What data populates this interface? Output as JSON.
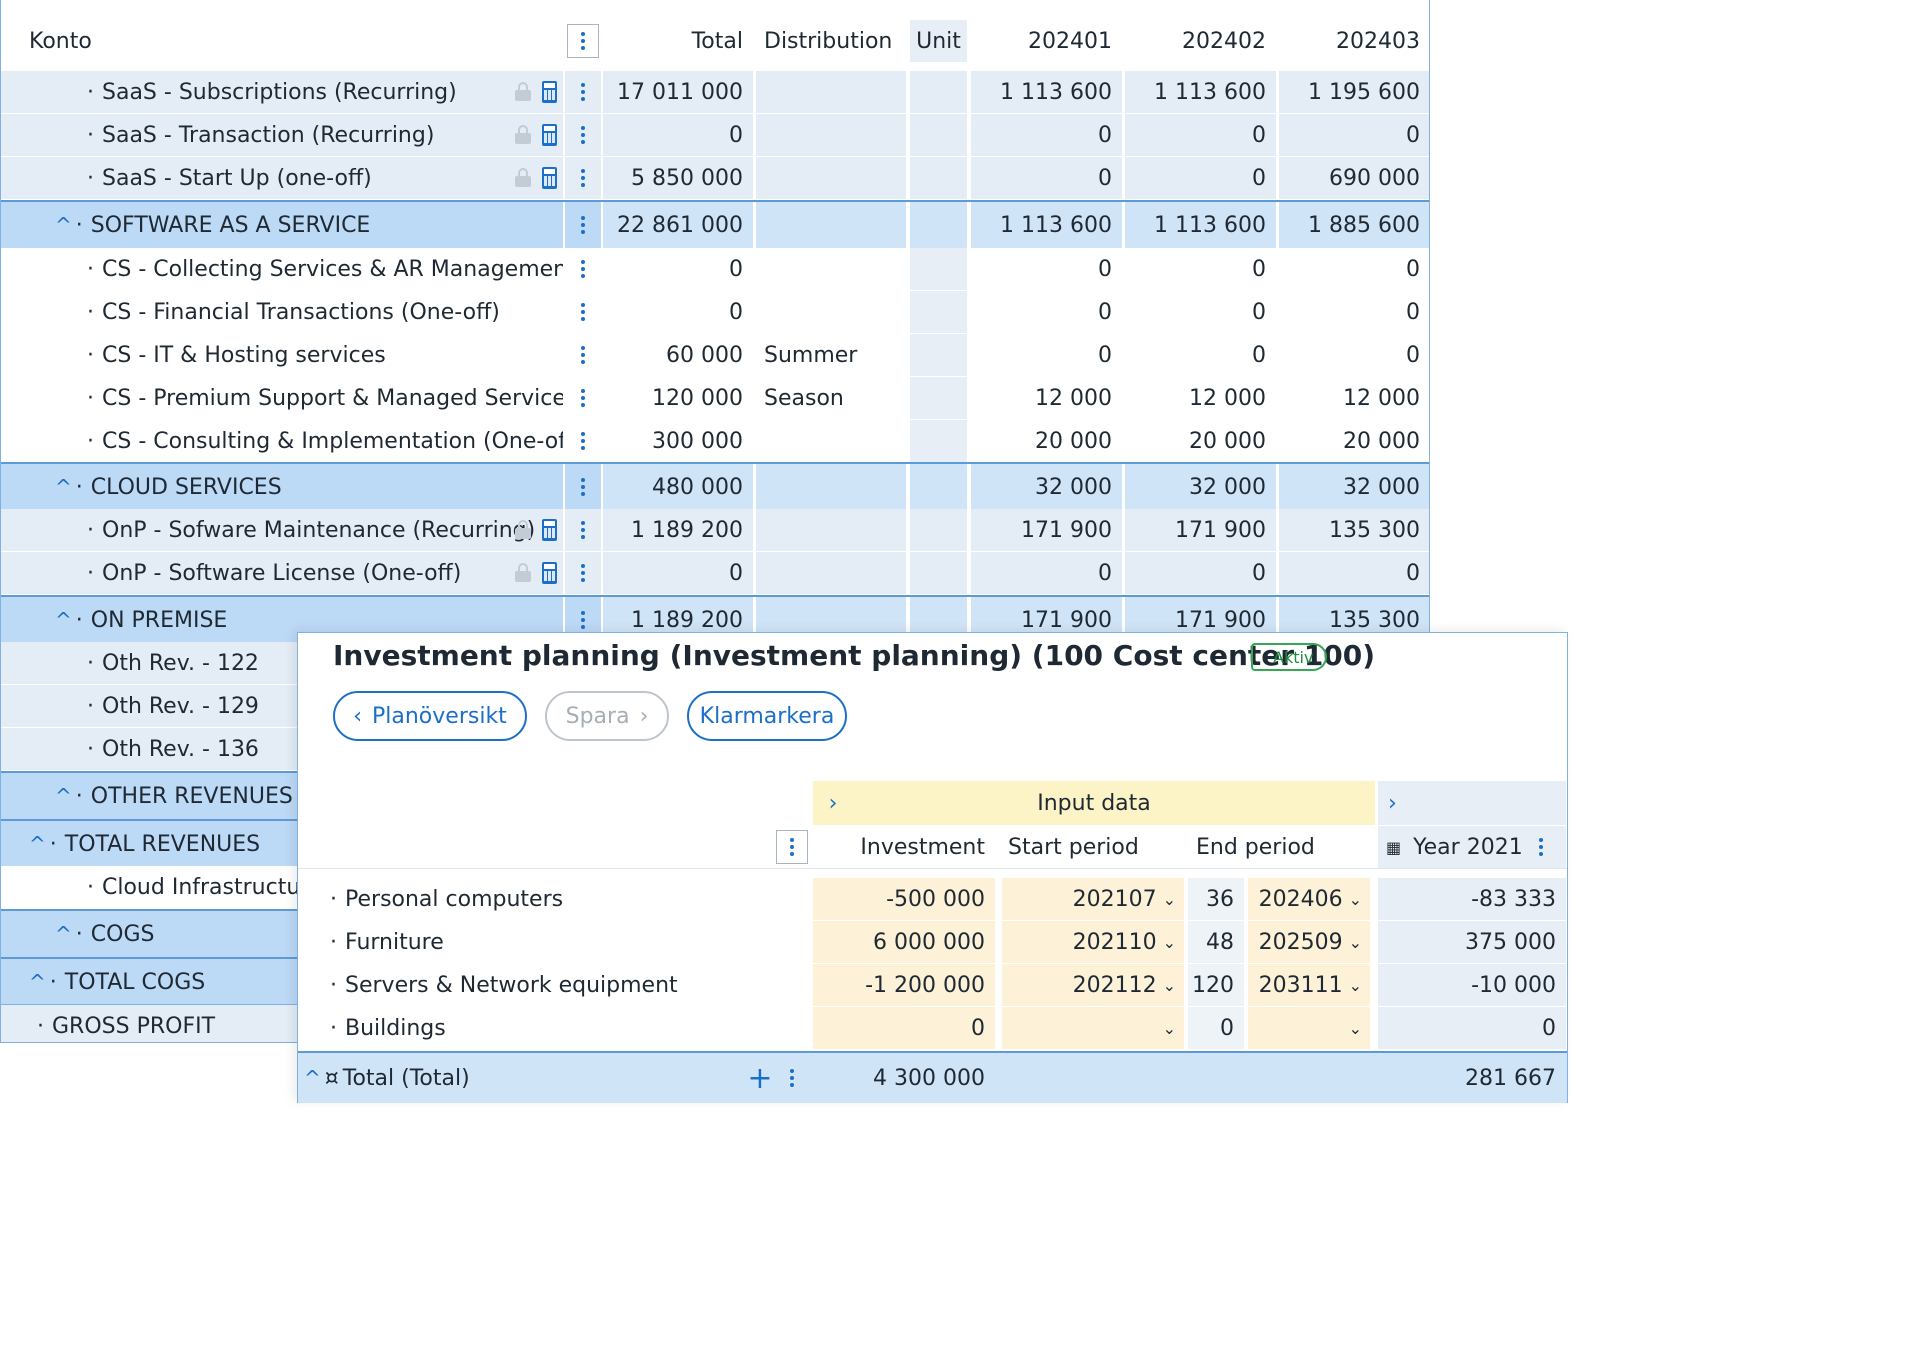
{
  "grid": {
    "headers": {
      "konto": "Konto",
      "total": "Total",
      "distribution": "Distribution",
      "unit": "Unit",
      "m1": "202401",
      "m2": "202402",
      "m3": "202403"
    },
    "rows": [
      {
        "label": "SaaS - Subscriptions (Recurring)",
        "total": "17 011 000",
        "dist": "",
        "m1": "1 113 600",
        "m2": "1 113 600",
        "m3": "1 195 600"
      },
      {
        "label": "SaaS - Transaction (Recurring)",
        "total": "0",
        "dist": "",
        "m1": "0",
        "m2": "0",
        "m3": "0"
      },
      {
        "label": "SaaS - Start Up (one-off)",
        "total": "5 850 000",
        "dist": "",
        "m1": "0",
        "m2": "0",
        "m3": "690 000"
      },
      {
        "label": "SOFTWARE AS A SERVICE",
        "total": "22 861 000",
        "dist": "",
        "m1": "1 113 600",
        "m2": "1 113 600",
        "m3": "1 885 600"
      },
      {
        "label": "CS - Collecting Services & AR Management (O…",
        "total": "0",
        "dist": "",
        "m1": "0",
        "m2": "0",
        "m3": "0"
      },
      {
        "label": "CS - Financial Transactions (One-off)",
        "total": "0",
        "dist": "",
        "m1": "0",
        "m2": "0",
        "m3": "0"
      },
      {
        "label": "CS - IT & Hosting services",
        "total": "60 000",
        "dist": "Summer",
        "m1": "0",
        "m2": "0",
        "m3": "0"
      },
      {
        "label": "CS - Premium Support & Managed Services (O…",
        "total": "120 000",
        "dist": "Season",
        "m1": "12 000",
        "m2": "12 000",
        "m3": "12 000"
      },
      {
        "label": "CS - Consulting & Implementation (One-off)",
        "total": "300 000",
        "dist": "",
        "m1": "20 000",
        "m2": "20 000",
        "m3": "20 000"
      },
      {
        "label": "CLOUD SERVICES",
        "total": "480 000",
        "dist": "",
        "m1": "32 000",
        "m2": "32 000",
        "m3": "32 000"
      },
      {
        "label": "OnP - Sofware Maintenance (Recurring)",
        "total": "1 189 200",
        "dist": "",
        "m1": "171 900",
        "m2": "171 900",
        "m3": "135 300"
      },
      {
        "label": "OnP - Software License (One-off)",
        "total": "0",
        "dist": "",
        "m1": "0",
        "m2": "0",
        "m3": "0"
      },
      {
        "label": "ON PREMISE",
        "total": "1 189 200",
        "dist": "",
        "m1": "171 900",
        "m2": "171 900",
        "m3": "135 300"
      },
      {
        "label": "Oth Rev. - 122"
      },
      {
        "label": "Oth Rev. - 129"
      },
      {
        "label": "Oth Rev. - 136"
      },
      {
        "label": "OTHER REVENUES"
      },
      {
        "label": "TOTAL REVENUES"
      },
      {
        "label": "Cloud Infrastructure"
      },
      {
        "label": "COGS"
      },
      {
        "label": "TOTAL COGS"
      },
      {
        "label": "GROSS PROFIT"
      }
    ]
  },
  "panel": {
    "title": "Investment planning (Investment planning) (100 Cost center 100)",
    "status": "Aktiv",
    "buttons": {
      "overview": "Planöversikt",
      "save": "Spara",
      "mark": "Klarmarkera"
    },
    "group_header": "Input data",
    "columns": {
      "investment": "Investment",
      "start": "Start period",
      "end": "End period",
      "year": "Year 2021"
    },
    "rows": [
      {
        "label": "Personal computers",
        "investment": "-500 000",
        "start": "202107",
        "months": "36",
        "end": "202406",
        "year": "-83 333"
      },
      {
        "label": "Furniture",
        "investment": "6 000 000",
        "start": "202110",
        "months": "48",
        "end": "202509",
        "year": "375 000"
      },
      {
        "label": "Servers & Network equipment",
        "investment": "-1 200 000",
        "start": "202112",
        "months": "120",
        "end": "203111",
        "year": "-10 000"
      },
      {
        "label": "Buildings",
        "investment": "0",
        "start": "",
        "months": "0",
        "end": "",
        "year": "0"
      }
    ],
    "total": {
      "label": "Total (Total)",
      "investment": "4 300 000",
      "year": "281 667"
    }
  },
  "colors": {
    "accent": "#1c6fc9",
    "subtotal": "#bcd9f6",
    "locked": "#e4ecf6",
    "input": "#fdf1d8",
    "status": "#34a853"
  }
}
